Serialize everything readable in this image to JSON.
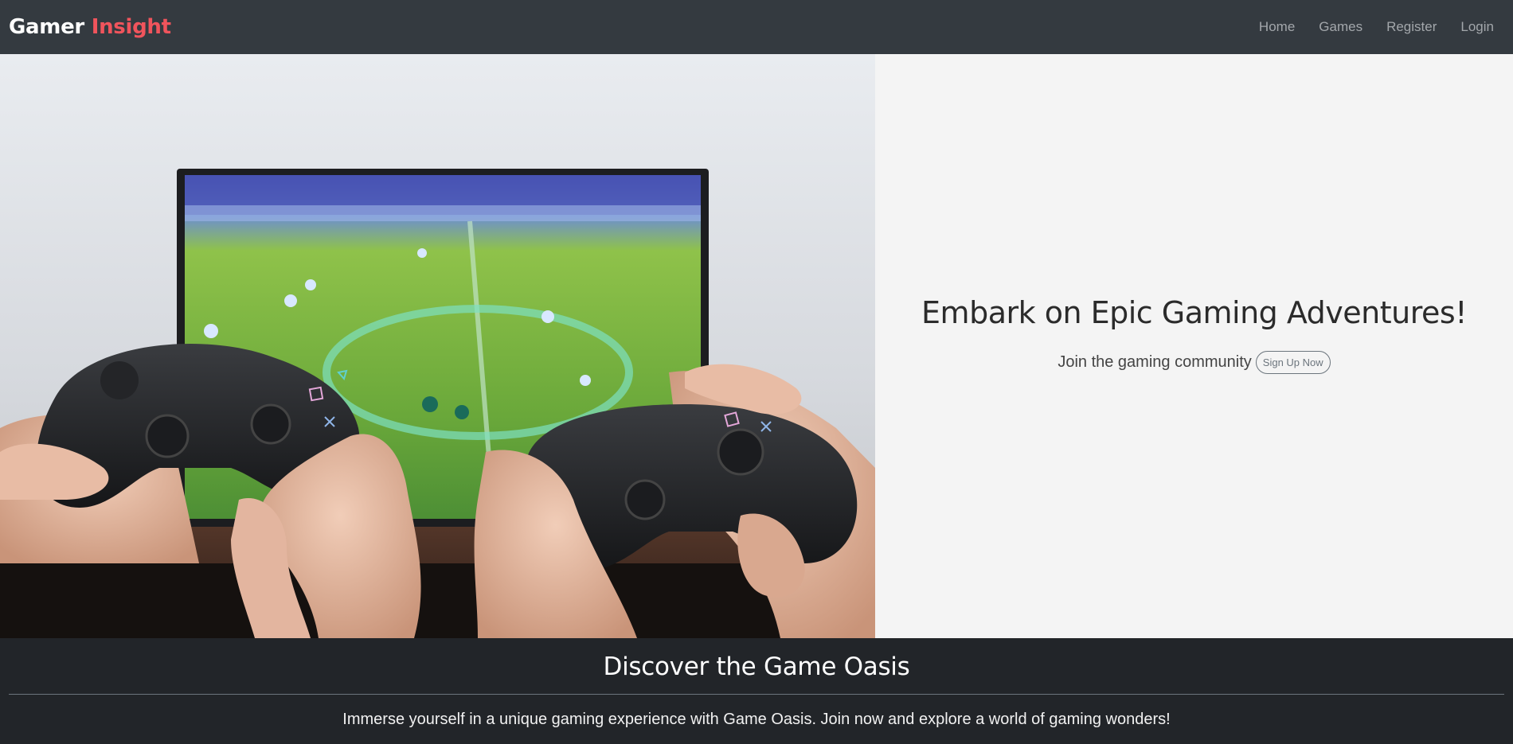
{
  "navbar": {
    "brand_primary": "Gamer",
    "brand_accent": "Insight",
    "links": [
      {
        "label": "Home"
      },
      {
        "label": "Games"
      },
      {
        "label": "Register"
      },
      {
        "label": "Login"
      }
    ],
    "accent_color": "#f0545c"
  },
  "hero": {
    "image_subject": "hands-holding-game-controllers-playing-football-game",
    "title": "Embark on Epic Gaming Adventures!",
    "subtitle": "Join the gaming community",
    "signup_label": "Sign Up Now"
  },
  "oasis": {
    "title": "Discover the Game Oasis",
    "description": "Immerse yourself in a unique gaming experience with Game Oasis. Join now and explore a world of gaming wonders!"
  }
}
